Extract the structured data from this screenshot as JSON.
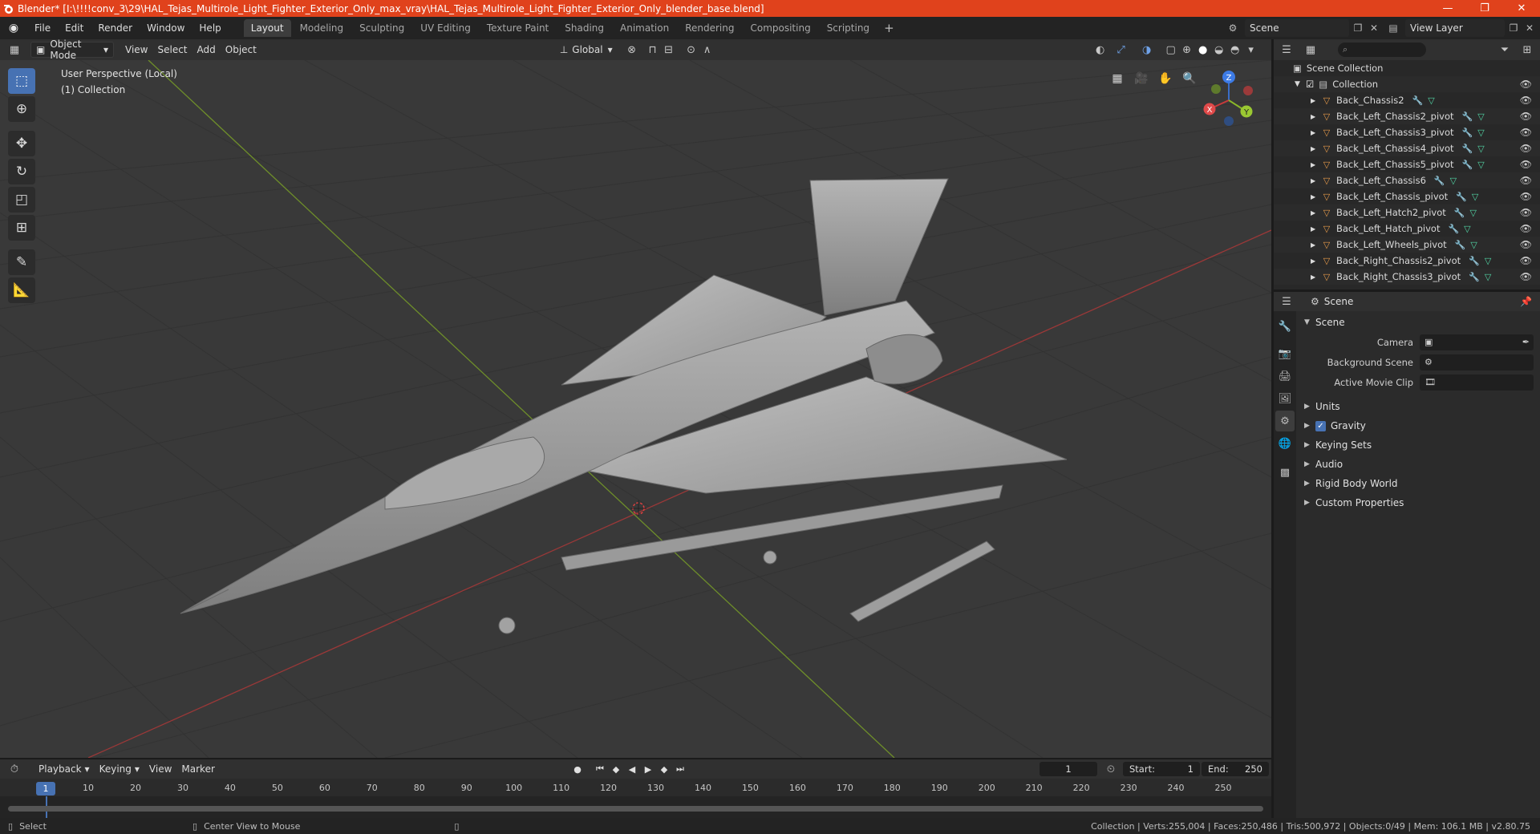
{
  "window": {
    "title": "Blender* [I:\\!!!!conv_3\\29\\HAL_Tejas_Multirole_Light_Fighter_Exterior_Only_max_vray\\HAL_Tejas_Multirole_Light_Fighter_Exterior_Only_blender_base.blend]",
    "accent_color": "#e0421c",
    "controls": {
      "minimize": "—",
      "maximize": "❐",
      "close": "✕"
    }
  },
  "menubar": {
    "items": [
      "File",
      "Edit",
      "Render",
      "Window",
      "Help"
    ],
    "workspaces": [
      "Layout",
      "Modeling",
      "Sculpting",
      "UV Editing",
      "Texture Paint",
      "Shading",
      "Animation",
      "Rendering",
      "Compositing",
      "Scripting"
    ],
    "active_workspace": "Layout",
    "add_workspace": "+",
    "scene": "Scene",
    "view_layer": "View Layer"
  },
  "viewport_header": {
    "mode": "Object Mode",
    "menus": [
      "View",
      "Select",
      "Add",
      "Object"
    ],
    "transform_orientation": "Global"
  },
  "viewport": {
    "perspective": "User Perspective (Local)",
    "collection": "(1) Collection",
    "background_color": "#393939",
    "gizmo": {
      "z": "Z",
      "x": "X",
      "y": "Y"
    },
    "icons": [
      "cursor-select-icon",
      "cursor-icon",
      "move-icon",
      "rotate-icon",
      "scale-icon",
      "transform-icon",
      "annotate-icon",
      "measure-icon"
    ]
  },
  "outliner": {
    "root": "Scene Collection",
    "collection": "Collection",
    "items": [
      "Back_Chassis2",
      "Back_Left_Chassis2_pivot",
      "Back_Left_Chassis3_pivot",
      "Back_Left_Chassis4_pivot",
      "Back_Left_Chassis5_pivot",
      "Back_Left_Chassis6",
      "Back_Left_Chassis_pivot",
      "Back_Left_Hatch2_pivot",
      "Back_Left_Hatch_pivot",
      "Back_Left_Wheels_pivot",
      "Back_Right_Chassis2_pivot",
      "Back_Right_Chassis3_pivot"
    ]
  },
  "properties": {
    "context": "Scene",
    "section": "Scene",
    "fields": [
      {
        "label": "Camera",
        "value": ""
      },
      {
        "label": "Background Scene",
        "value": ""
      },
      {
        "label": "Active Movie Clip",
        "value": ""
      }
    ],
    "panels": [
      "Units",
      "Gravity",
      "Keying Sets",
      "Audio",
      "Rigid Body World",
      "Custom Properties"
    ],
    "gravity_checked": true
  },
  "timeline": {
    "menus": [
      "Playback",
      "Keying",
      "View",
      "Marker"
    ],
    "current_frame": "1",
    "start_label": "Start:",
    "start": "1",
    "end_label": "End:",
    "end": "250",
    "ticks": [
      "1",
      "10",
      "20",
      "30",
      "40",
      "50",
      "60",
      "70",
      "80",
      "90",
      "100",
      "110",
      "120",
      "130",
      "140",
      "150",
      "160",
      "170",
      "180",
      "190",
      "200",
      "210",
      "220",
      "230",
      "240",
      "250"
    ]
  },
  "statusbar": {
    "left_action": "Select",
    "middle_action": "Center View to Mouse",
    "stats": "Collection | Verts:255,004 | Faces:250,486 | Tris:500,972 | Objects:0/49 | Mem: 106.1 MB | v2.80.75"
  }
}
